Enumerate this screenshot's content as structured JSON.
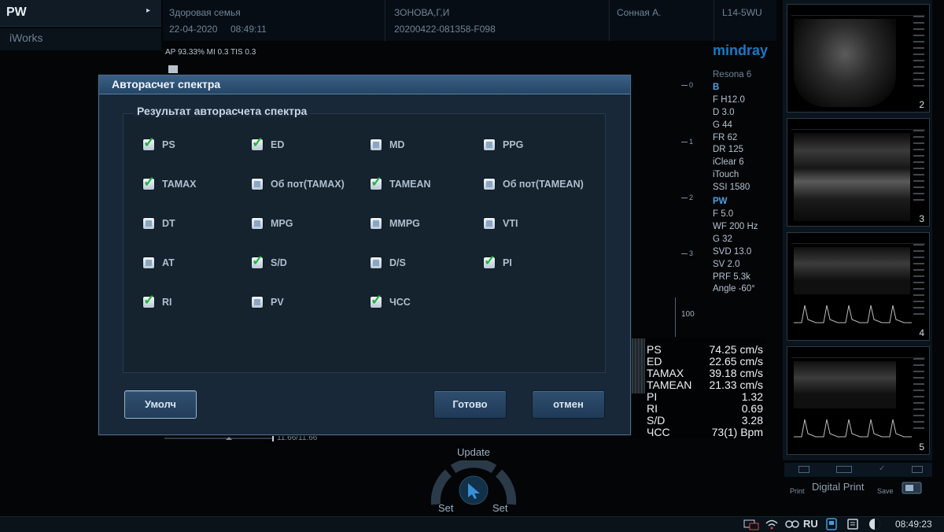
{
  "mode": {
    "label": "PW",
    "arrow": "▸"
  },
  "iworks": "iWorks",
  "patient": {
    "exam": "Здоровая семья",
    "date": "22-04-2020",
    "time": "08:49:11",
    "name": "ЗОНОВА,Г,И",
    "id": "20200422-081358-F098",
    "doctor": "Сонная А.",
    "probe": "L14-5WU"
  },
  "acoustic": "AP 93.33%  MI 0.3 TIS 0.3",
  "logo": "mindray",
  "params": {
    "system": "Resona 6",
    "b_mode": "B",
    "b": [
      "F H12.0",
      "D 3.0",
      "G 44",
      "FR 62",
      "DR 125",
      "iClear 6",
      "iTouch",
      "SSI 1580"
    ],
    "pw_mode": "PW",
    "pw": [
      "F 5.0",
      "WF 200 Hz",
      "G 32",
      "SVD 13.0",
      "SV 2.0",
      "PRF 5.3k",
      "Angle    -60°"
    ]
  },
  "depth_scale": [
    "0",
    "1",
    "2",
    "3"
  ],
  "velocity_scale": "100",
  "measurements": [
    {
      "key": "PS",
      "value": "74.25 cm/s"
    },
    {
      "key": "ED",
      "value": "22.65 cm/s"
    },
    {
      "key": "TAMAX",
      "value": "39.18 cm/s"
    },
    {
      "key": "TAMEAN",
      "value": "21.33 cm/s"
    },
    {
      "key": "PI",
      "value": "1.32"
    },
    {
      "key": "RI",
      "value": "0.69"
    },
    {
      "key": "S/D",
      "value": "3.28"
    },
    {
      "key": "ЧСС",
      "value": "73(1) Bpm"
    }
  ],
  "thumbnails": [
    "2",
    "3",
    "4",
    "5"
  ],
  "print": {
    "print_label": "Print",
    "digital_print": "Digital Print",
    "save_label": "Save"
  },
  "trackball": {
    "update": "Update",
    "set_left": "Set",
    "set_right": "Set"
  },
  "timeline": "11.66/11.66",
  "taskbar": {
    "lang": "RU",
    "clock": "08:49:23"
  },
  "dialog": {
    "title": "Авторасчет спектра",
    "group_title": "Результат авторасчета спектра",
    "options": [
      {
        "label": "PS",
        "checked": true
      },
      {
        "label": "ED",
        "checked": true
      },
      {
        "label": "MD",
        "checked": false
      },
      {
        "label": "PPG",
        "checked": false
      },
      {
        "label": "TAMAX",
        "checked": true
      },
      {
        "label": "Об пот(TAMAX)",
        "checked": false
      },
      {
        "label": "TAMEAN",
        "checked": true
      },
      {
        "label": "Об пот(TAMEAN)",
        "checked": false
      },
      {
        "label": "DT",
        "checked": false
      },
      {
        "label": "MPG",
        "checked": false
      },
      {
        "label": "MMPG",
        "checked": false
      },
      {
        "label": "VTI",
        "checked": false
      },
      {
        "label": "AT",
        "checked": false
      },
      {
        "label": "S/D",
        "checked": true
      },
      {
        "label": "D/S",
        "checked": false
      },
      {
        "label": "PI",
        "checked": true
      },
      {
        "label": "RI",
        "checked": true
      },
      {
        "label": "PV",
        "checked": false
      },
      {
        "label": "ЧСС",
        "checked": true
      }
    ],
    "buttons": {
      "default": "Умолч",
      "done": "Готово",
      "cancel": "отмен"
    }
  }
}
